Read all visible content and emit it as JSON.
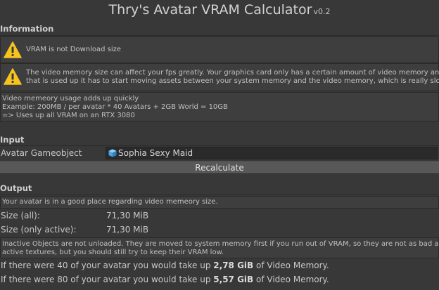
{
  "title": {
    "main": "Thry's Avatar VRAM Calculator",
    "version": "v0.2"
  },
  "information": {
    "header": "Information",
    "warning1": "VRAM is not Download size",
    "warning2_line1": "The video memory size can affect your fps greatly. Your graphics card only has a certain amount of video memory and if",
    "warning2_line2": "that is used up it has to start moving assets between your system memory and the video memory, which is really slow.",
    "note_line1": "Video memeory usage adds up quickly",
    "note_line2": "Example: 200MB / per avatar * 40 Avatars + 2GB World = 10GB",
    "note_line3": "=> Uses up all VRAM on an RTX 3080"
  },
  "input": {
    "header": "Input",
    "avatar_label": "Avatar Gameobject",
    "avatar_value": "Sophia Sexy Maid",
    "recalculate": "Recalculate"
  },
  "output": {
    "header": "Output",
    "status": "Your avatar is in a good place regarding video memeory size.",
    "size_all_label": "Size (all):",
    "size_all_value": "71,30 MiB",
    "size_active_label": "Size (only active):",
    "size_active_value": "71,30 MiB",
    "inactive_line1": "Inactive Objects are not unloaded. They are moved to system memory first if you run out of VRAM, so they are not as bad as",
    "inactive_line2": "active textures, but you should still try to keep their VRAM low.",
    "line40_pre": "If there were 40 of your avatar you would take up ",
    "line40_val": "2,78 GiB",
    "line40_post": " of Video Memory.",
    "line80_pre": "If there were 80 of your avatar you would take up ",
    "line80_val": "5,57 GiB",
    "line80_post": " of Video Memory."
  },
  "colors": {
    "background": "#383838",
    "warning": "#f7c31e",
    "prefab_icon": "#4aa3e0"
  }
}
